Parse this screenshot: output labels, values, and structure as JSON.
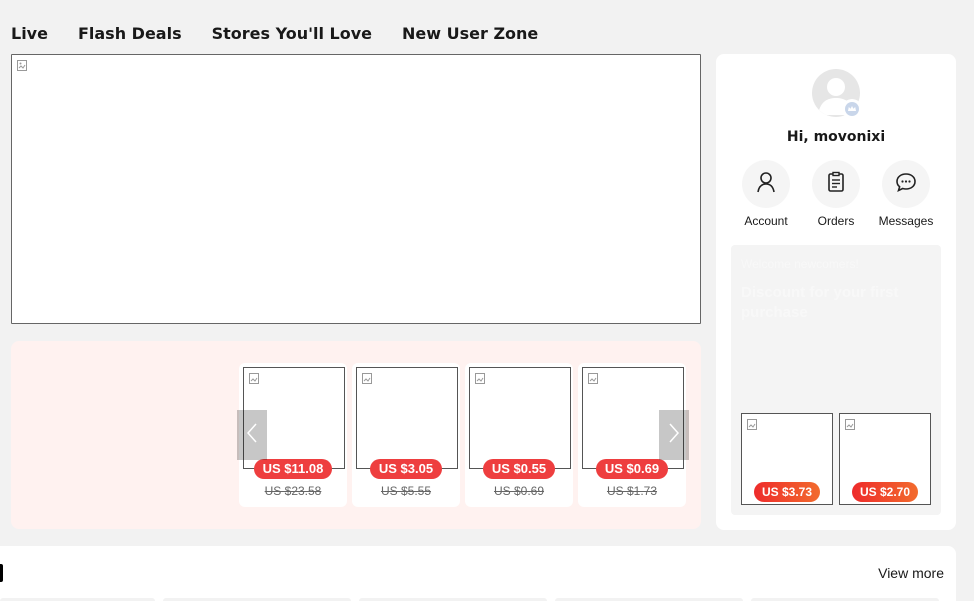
{
  "nav": {
    "items": [
      "Live",
      "Flash Deals",
      "Stores You'll Love",
      "New User Zone"
    ]
  },
  "deals": {
    "items": [
      {
        "price": "US $11.08",
        "original": "US $23.58"
      },
      {
        "price": "US $3.05",
        "original": "US $5.55"
      },
      {
        "price": "US $0.55",
        "original": "US $0.69"
      },
      {
        "price": "US $0.69",
        "original": "US $1.73"
      }
    ]
  },
  "user": {
    "greeting": "Hi, movonixi",
    "quick_links": [
      "Account",
      "Orders",
      "Messages"
    ]
  },
  "welcome": {
    "small": "Welcome newcomers!",
    "big": "Discount for your first purchase",
    "items": [
      {
        "price": "US $3.73"
      },
      {
        "price": "US $2.70"
      }
    ]
  },
  "section": {
    "view_more": "View more"
  },
  "colors": {
    "accent": "#ee3e3f",
    "deals_bg": "#fff2f0",
    "page_bg": "#f2f2f2"
  }
}
